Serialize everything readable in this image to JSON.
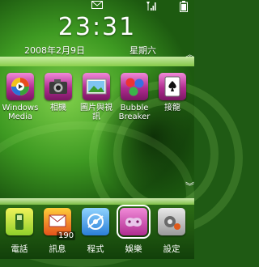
{
  "status": {
    "icons": [
      "mail-icon",
      "signal-icon",
      "battery-icon"
    ]
  },
  "today": {
    "time": "23:31",
    "date": "2008年2月9日",
    "weekday": "星期六"
  },
  "apps": [
    {
      "label": "Windows Media",
      "icon": "windows-media-icon"
    },
    {
      "label": "相機",
      "icon": "camera-icon"
    },
    {
      "label": "圖片與視訊",
      "icon": "pictures-videos-icon"
    },
    {
      "label": "Bubble Breaker",
      "icon": "bubble-breaker-icon"
    },
    {
      "label": "接龍",
      "icon": "solitaire-icon"
    }
  ],
  "dock": [
    {
      "label": "電話",
      "icon": "phone-icon"
    },
    {
      "label": "訊息",
      "icon": "messaging-icon",
      "badge": "190"
    },
    {
      "label": "程式",
      "icon": "programs-icon"
    },
    {
      "label": "娛樂",
      "icon": "entertainment-icon",
      "selected": true
    },
    {
      "label": "設定",
      "icon": "settings-icon"
    }
  ],
  "colors": {
    "tile_pink": "#c43aa3",
    "bar_green": "#a6e06a",
    "dock_bg": "#1f5a10"
  }
}
